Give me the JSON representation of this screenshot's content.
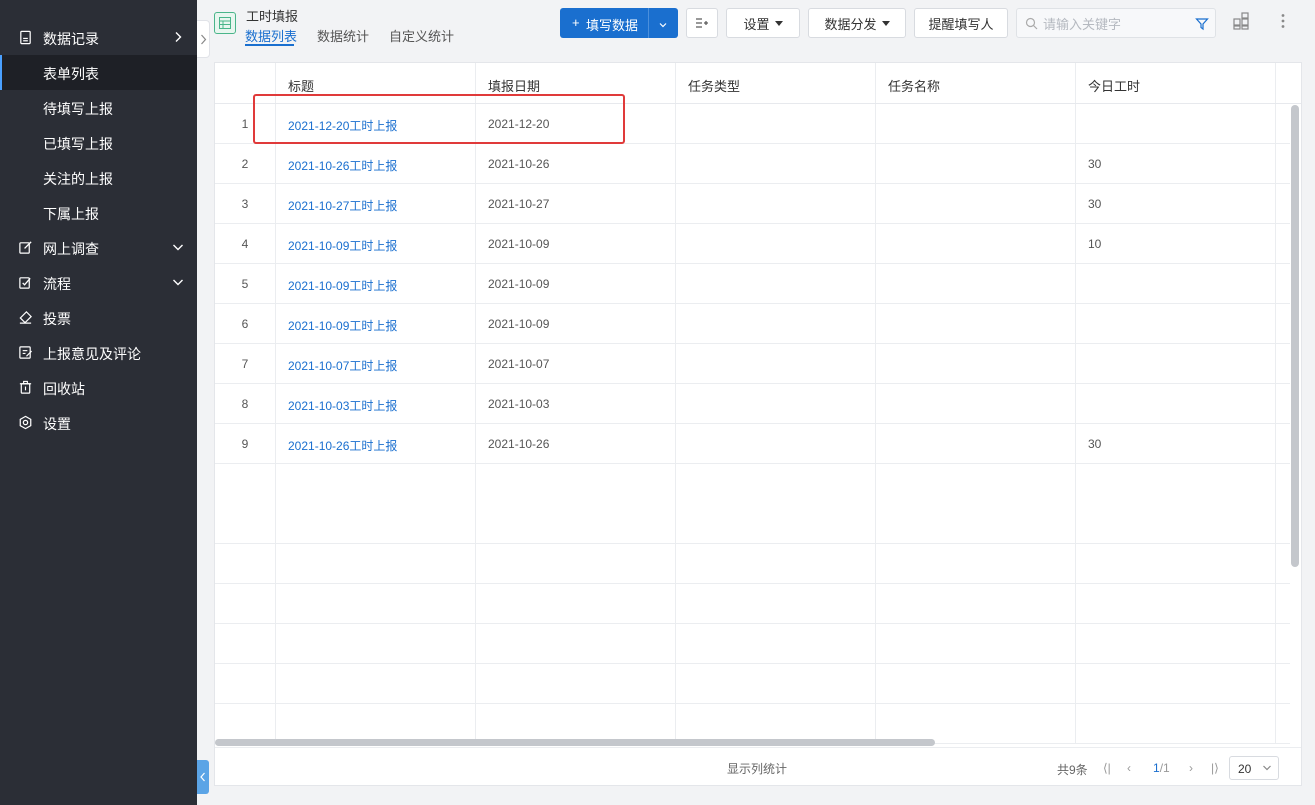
{
  "sidebar": {
    "items": [
      {
        "label": "数据记录",
        "icon": "document-icon",
        "expanded": true
      },
      {
        "label": "表单列表",
        "active": true
      },
      {
        "label": "待填写上报"
      },
      {
        "label": "已填写上报"
      },
      {
        "label": "关注的上报"
      },
      {
        "label": "下属上报"
      },
      {
        "label": "网上调查",
        "icon": "edit-icon"
      },
      {
        "label": "流程",
        "icon": "checklist-icon"
      },
      {
        "label": "投票",
        "icon": "eraser-icon"
      },
      {
        "label": "上报意见及评论",
        "icon": "feedback-icon"
      },
      {
        "label": "回收站",
        "icon": "trash-icon"
      },
      {
        "label": "设置",
        "icon": "gear-icon"
      }
    ]
  },
  "header": {
    "title": "工时填报",
    "tabs": [
      "数据列表",
      "数据统计",
      "自定义统计"
    ],
    "fill_button": "填写数据",
    "settings_button": "设置",
    "distribute_button": "数据分发",
    "remind_button": "提醒填写人",
    "search_placeholder": "请输入关键字"
  },
  "table": {
    "columns": [
      "标题",
      "填报日期",
      "任务类型",
      "任务名称",
      "今日工时"
    ],
    "rows": [
      {
        "idx": "1",
        "title": "2021-12-20工时上报",
        "date": "2021-12-20",
        "type": "",
        "name": "",
        "hours": ""
      },
      {
        "idx": "2",
        "title": "2021-10-26工时上报",
        "date": "2021-10-26",
        "type": "",
        "name": "",
        "hours": "30"
      },
      {
        "idx": "3",
        "title": "2021-10-27工时上报",
        "date": "2021-10-27",
        "type": "",
        "name": "",
        "hours": "30"
      },
      {
        "idx": "4",
        "title": "2021-10-09工时上报",
        "date": "2021-10-09",
        "type": "",
        "name": "",
        "hours": "10"
      },
      {
        "idx": "5",
        "title": "2021-10-09工时上报",
        "date": "2021-10-09",
        "type": "",
        "name": "",
        "hours": ""
      },
      {
        "idx": "6",
        "title": "2021-10-09工时上报",
        "date": "2021-10-09",
        "type": "",
        "name": "",
        "hours": ""
      },
      {
        "idx": "7",
        "title": "2021-10-07工时上报",
        "date": "2021-10-07",
        "type": "",
        "name": "",
        "hours": ""
      },
      {
        "idx": "8",
        "title": "2021-10-03工时上报",
        "date": "2021-10-03",
        "type": "",
        "name": "",
        "hours": ""
      },
      {
        "idx": "9",
        "title": "2021-10-26工时上报",
        "date": "2021-10-26",
        "type": "",
        "name": "",
        "hours": "30"
      }
    ]
  },
  "footer": {
    "stats_label": "显示列统计",
    "total": "共9条",
    "page": "1",
    "pages": "/1",
    "page_size": "20"
  },
  "colors": {
    "sidebar_bg": "#2b2e36",
    "accent": "#1a6fcf",
    "highlight": "#e03a3a"
  }
}
